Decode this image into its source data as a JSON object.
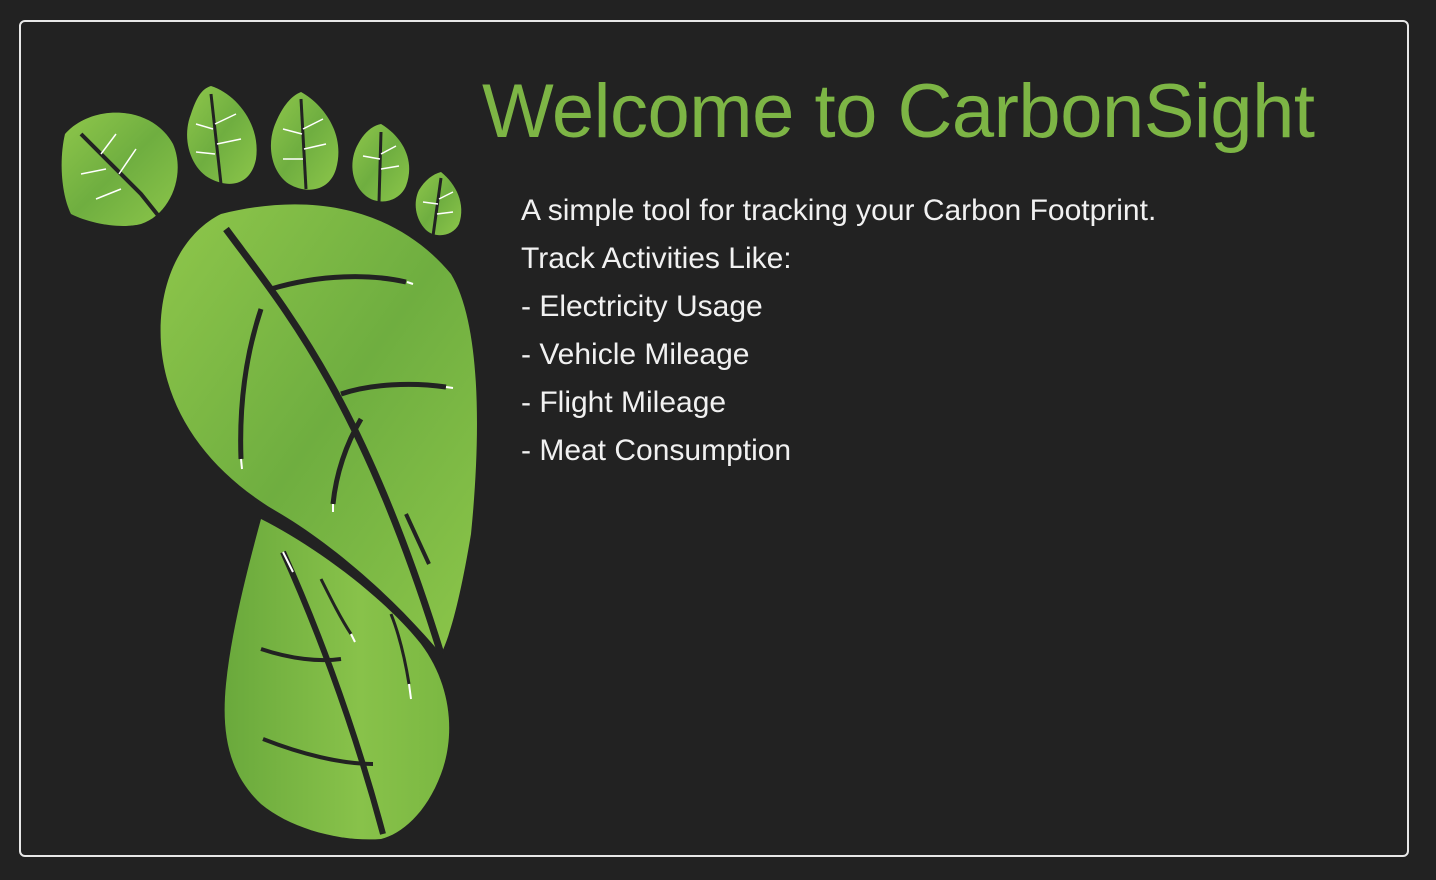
{
  "colors": {
    "background": "#222222",
    "border": "#e8e8e8",
    "accent": "#7db545",
    "text": "#f1f1f1"
  },
  "logo": {
    "icon": "leaf-footprint-icon"
  },
  "welcome": {
    "title": "Welcome to CarbonSight",
    "tagline": "A simple tool for tracking your Carbon Footprint.",
    "activities_heading": "Track Activities Like:",
    "activities": [
      "- Electricity Usage",
      "- Vehicle Mileage",
      "- Flight Mileage",
      "- Meat Consumption"
    ]
  }
}
